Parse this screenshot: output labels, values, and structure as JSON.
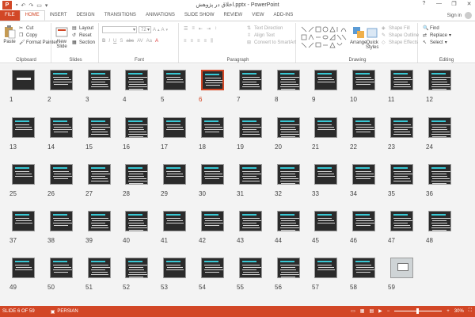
{
  "app": {
    "title": "اخلاق در پژوهش.pptx - PowerPoint",
    "logo_letter": "P",
    "signin": "Sign in",
    "window_controls": [
      "?",
      "—",
      "❐",
      "✕"
    ]
  },
  "tabs": [
    "FILE",
    "HOME",
    "INSERT",
    "DESIGN",
    "TRANSITIONS",
    "ANIMATIONS",
    "SLIDE SHOW",
    "REVIEW",
    "VIEW",
    "ADD-INS"
  ],
  "active_tab": "HOME",
  "ribbon": {
    "clipboard": {
      "paste": "Paste",
      "cut": "Cut",
      "copy": "Copy",
      "format_painter": "Format Painter",
      "label": "Clipboard"
    },
    "slides": {
      "new_slide": "New",
      "new_slide2": "Slide",
      "layout": "Layout",
      "reset": "Reset",
      "section": "Section",
      "label": "Slides"
    },
    "font": {
      "size": "72",
      "label": "Font",
      "buttons": [
        "B",
        "I",
        "U",
        "S",
        "abc",
        "AV",
        "Aa",
        "A"
      ]
    },
    "paragraph": {
      "text_direction": "Text Direction",
      "align_text": "Align Text",
      "smartart": "Convert to SmartArt",
      "label": "Paragraph"
    },
    "drawing": {
      "arrange": "Arrange",
      "quick_styles": "Quick",
      "quick_styles2": "Styles",
      "shape_fill": "Shape Fill",
      "shape_outline": "Shape Outline",
      "shape_effects": "Shape Effects",
      "label": "Drawing"
    },
    "editing": {
      "find": "Find",
      "replace": "Replace",
      "select": "Select",
      "label": "Editing"
    }
  },
  "slides": {
    "count": 59,
    "selected": 6,
    "numbers": [
      "1",
      "2",
      "3",
      "4",
      "5",
      "6",
      "7",
      "8",
      "9",
      "10",
      "11",
      "12",
      "13",
      "14",
      "15",
      "16",
      "17",
      "18",
      "19",
      "20",
      "21",
      "22",
      "23",
      "24",
      "25",
      "26",
      "27",
      "28",
      "29",
      "30",
      "31",
      "32",
      "33",
      "34",
      "35",
      "36",
      "37",
      "38",
      "39",
      "40",
      "41",
      "42",
      "43",
      "44",
      "45",
      "46",
      "47",
      "48",
      "49",
      "50",
      "51",
      "52",
      "53",
      "54",
      "55",
      "56",
      "57",
      "58",
      "59"
    ]
  },
  "status": {
    "slide_info": "SLIDE 6 OF 59",
    "language": "PERSIAN",
    "zoom": "30%"
  },
  "colors": {
    "accent": "#d24726",
    "slide_bg": "#2b2b2b",
    "slide_title": "#38c8d4"
  }
}
